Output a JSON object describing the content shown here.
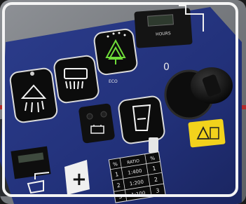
{
  "photo": {
    "subject": "machine control panel",
    "panel_color": "#22317a",
    "accent_color": "#f2d21c"
  },
  "display": {
    "label": "HOURS"
  },
  "buttons": [
    {
      "id": "filter",
      "icon": "filter-shake-icon"
    },
    {
      "id": "brush",
      "icon": "brush-icon"
    },
    {
      "id": "eco",
      "icon": "tree-icon"
    },
    {
      "id": "water",
      "icon": "water-tank-icon"
    },
    {
      "id": "fan",
      "icon": "fan-icon"
    }
  ],
  "indicators": {
    "battery": "battery-icon",
    "eco_label": "ECO"
  },
  "key_switch": {
    "off_mark": "0"
  },
  "warning_label": {
    "icons": [
      "warning-triangle-icon",
      "manual-icon"
    ]
  },
  "table": {
    "headers": [
      "%",
      "RATIO",
      "%"
    ],
    "rows": [
      [
        "1",
        "1:400",
        "1"
      ],
      [
        "2",
        "1:200",
        "2"
      ],
      [
        "3",
        "1:100",
        "3"
      ]
    ]
  }
}
